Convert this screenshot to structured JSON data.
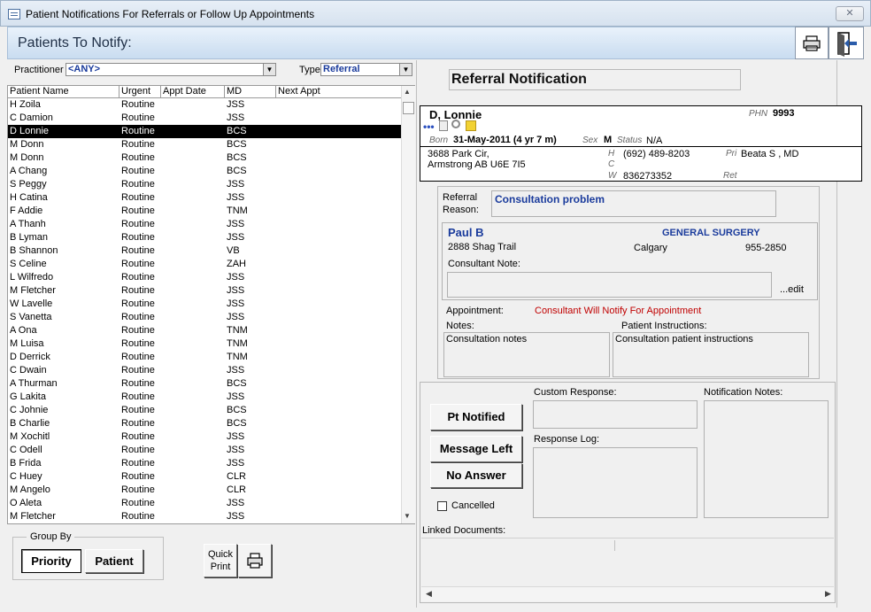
{
  "window": {
    "title": "Patient Notifications For Referrals or Follow Up Appointments",
    "close": "✕"
  },
  "header": {
    "title": "Patients To Notify:"
  },
  "filters": {
    "practitioner_label": "Practitioner",
    "practitioner_value": "<ANY>",
    "type_label": "Type",
    "type_value": "Referral"
  },
  "grid": {
    "columns": [
      "Patient Name",
      "Urgent",
      "Appt Date",
      "MD",
      "Next Appt"
    ],
    "rows": [
      [
        "H Zoila",
        "Routine",
        "",
        "JSS",
        ""
      ],
      [
        "C Damion",
        "Routine",
        "",
        "JSS",
        ""
      ],
      [
        "D Lonnie",
        "Routine",
        "",
        "BCS",
        ""
      ],
      [
        "M Donn",
        "Routine",
        "",
        "BCS",
        ""
      ],
      [
        "M Donn",
        "Routine",
        "",
        "BCS",
        ""
      ],
      [
        "A Chang",
        "Routine",
        "",
        "BCS",
        ""
      ],
      [
        "S Peggy",
        "Routine",
        "",
        "JSS",
        ""
      ],
      [
        "H Catina",
        "Routine",
        "",
        "JSS",
        ""
      ],
      [
        "F Addie",
        "Routine",
        "",
        "TNM",
        ""
      ],
      [
        "A Thanh",
        "Routine",
        "",
        "JSS",
        ""
      ],
      [
        "B Lyman",
        "Routine",
        "",
        "JSS",
        ""
      ],
      [
        "B Shannon",
        "Routine",
        "",
        "VB",
        ""
      ],
      [
        "S Celine",
        "Routine",
        "",
        "ZAH",
        ""
      ],
      [
        "L Wilfredo",
        "Routine",
        "",
        "JSS",
        ""
      ],
      [
        "M Fletcher",
        "Routine",
        "",
        "JSS",
        ""
      ],
      [
        "W Lavelle",
        "Routine",
        "",
        "JSS",
        ""
      ],
      [
        "S Vanetta",
        "Routine",
        "",
        "JSS",
        ""
      ],
      [
        "A Ona",
        "Routine",
        "",
        "TNM",
        ""
      ],
      [
        "M Luisa",
        "Routine",
        "",
        "TNM",
        ""
      ],
      [
        "D Derrick",
        "Routine",
        "",
        "TNM",
        ""
      ],
      [
        "C Dwain",
        "Routine",
        "",
        "JSS",
        ""
      ],
      [
        "A Thurman",
        "Routine",
        "",
        "BCS",
        ""
      ],
      [
        "G Lakita",
        "Routine",
        "",
        "JSS",
        ""
      ],
      [
        "C Johnie",
        "Routine",
        "",
        "BCS",
        ""
      ],
      [
        "B Charlie",
        "Routine",
        "",
        "BCS",
        ""
      ],
      [
        "M Xochitl",
        "Routine",
        "",
        "JSS",
        ""
      ],
      [
        "C Odell",
        "Routine",
        "",
        "JSS",
        ""
      ],
      [
        "B Frida",
        "Routine",
        "",
        "JSS",
        ""
      ],
      [
        "C Huey",
        "Routine",
        "",
        "CLR",
        ""
      ],
      [
        "M Angelo",
        "Routine",
        "",
        "CLR",
        ""
      ],
      [
        "O Aleta",
        "Routine",
        "",
        "JSS",
        ""
      ],
      [
        "M Fletcher",
        "Routine",
        "",
        "JSS",
        ""
      ]
    ],
    "selected_index": 2
  },
  "groupby": {
    "label": "Group By",
    "priority": "Priority",
    "patient": "Patient"
  },
  "quickprint": {
    "line1": "Quick",
    "line2": "Print"
  },
  "notification": {
    "title": "Referral Notification"
  },
  "patient": {
    "name": "D, Lonnie",
    "phn_label": "PHN",
    "phn": "9993",
    "born_label": "Born",
    "born": "31-May-2011 (4 yr 7 m)",
    "sex_label": "Sex",
    "sex": "M",
    "status_label": "Status",
    "status": "N/A",
    "addr1": "3688 Park Cir,",
    "addr2": "Armstrong AB  U6E 7I5",
    "h_label": "H",
    "phone_h": "(692) 489-8203",
    "c_label": "C",
    "w_label": "W",
    "phone_w": "836273352",
    "pri_label": "Pri",
    "pri": "Beata S , MD",
    "ret_label": "Ret"
  },
  "referral": {
    "reason_label1": "Referral",
    "reason_label2": "Reason:",
    "reason": "Consultation problem",
    "consultant": "Paul B",
    "specialty": "GENERAL SURGERY",
    "address": "2888 Shag Trail",
    "city": "Calgary",
    "phone": "955-2850",
    "consultant_note_label": "Consultant Note:",
    "edit": "...edit",
    "appointment_label": "Appointment:",
    "appointment": "Consultant Will Notify For Appointment",
    "notes_label": "Notes:",
    "notes": "Consultation notes",
    "instructions_label": "Patient Instructions:",
    "instructions": "Consultation patient instructions"
  },
  "response": {
    "custom_label": "Custom Response:",
    "notif_notes_label": "Notification Notes:",
    "pt_notified": "Pt Notified",
    "message_left": "Message Left",
    "no_answer": "No Answer",
    "response_log_label": "Response Log:",
    "cancelled": "Cancelled",
    "linked_docs_label": "Linked Documents:"
  },
  "colors": {
    "header_bg": "#c9dcf0",
    "selected_row": "#000000",
    "appointment_text": "#c00000",
    "accent_text": "#1a3b9c"
  }
}
